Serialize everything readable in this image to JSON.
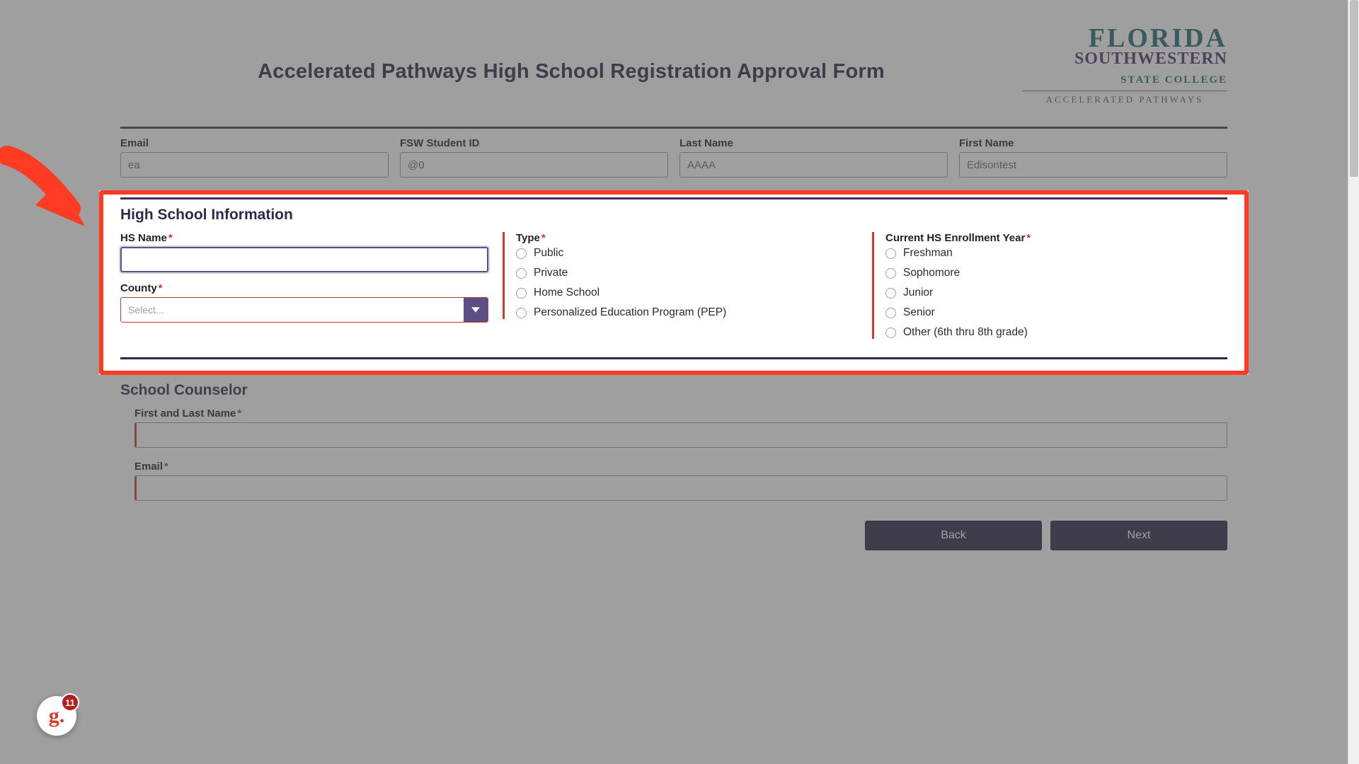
{
  "header": {
    "title": "Accelerated Pathways High School Registration Approval Form",
    "logo": {
      "line1": "FLORIDA",
      "line2a": "SOUTHWESTERN",
      "line2b": "STATE COLLEGE",
      "line3": "ACCELERATED PATHWAYS"
    }
  },
  "personal": {
    "email_label": "Email",
    "email_value": "ea",
    "fswid_label": "FSW Student ID",
    "fswid_value": "@0",
    "lastname_label": "Last Name",
    "lastname_value": "AAAA",
    "firstname_label": "First Name",
    "firstname_value": "Edisontest"
  },
  "hs": {
    "heading": "High School Information",
    "hsname_label": "HS Name",
    "hsname_value": "",
    "county_label": "County",
    "county_placeholder": "Select...",
    "type_label": "Type",
    "type_options": [
      "Public",
      "Private",
      "Home School",
      "Personalized Education Program (PEP)"
    ],
    "year_label": "Current HS Enrollment Year",
    "year_options": [
      "Freshman",
      "Sophomore",
      "Junior",
      "Senior",
      "Other (6th thru 8th grade)"
    ]
  },
  "counselor": {
    "heading": "School Counselor",
    "name_label": "First and Last Name",
    "name_value": "",
    "email_label": "Email",
    "email_value": ""
  },
  "buttons": {
    "back": "Back",
    "next": "Next"
  },
  "badge": {
    "letter": "g.",
    "count": "11"
  }
}
